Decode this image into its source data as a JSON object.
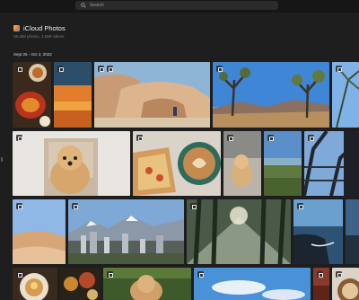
{
  "search": {
    "placeholder": "Search"
  },
  "header": {
    "title": "iCloud Photos",
    "subtitle": "38,458 photos, 1,550 videos",
    "date_range": "Sept 25 - Oct 3, 2022"
  },
  "colors": {
    "background": "#1e1e1e",
    "topbar": "#161616",
    "search_field": "#2b2b2b"
  },
  "photos": [
    "food-plates",
    "orange-beach",
    "desert-rocks",
    "joshua-tree",
    "palm-fronds",
    "dog-chair",
    "toast-coffee",
    "dog-blanket",
    "grass-lake",
    "eiffel-tower",
    "desert-dune",
    "city-mountains",
    "forest-sunlight",
    "ocean-sunset",
    "coastal-rocks",
    "pancakes",
    "market-food",
    "dog-grass",
    "blue-sky",
    "red-room",
    "latte"
  ]
}
